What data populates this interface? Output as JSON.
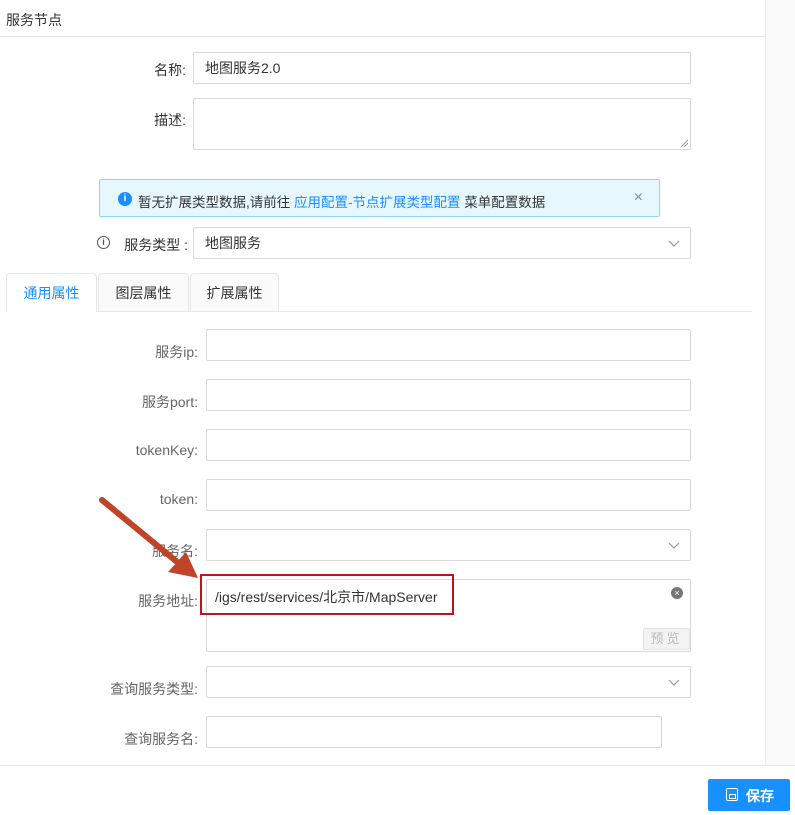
{
  "header": {
    "title": "服务节点"
  },
  "form": {
    "name_label": "名称:",
    "name_value": "地图服务2.0",
    "desc_label": "描述:",
    "desc_value": ""
  },
  "alert": {
    "text_prefix": "暂无扩展类型数据,请前往 ",
    "link": "应用配置-节点扩展类型配置",
    "text_suffix": " 菜单配置数据",
    "close": "×"
  },
  "service_type": {
    "label": "服务类型 :",
    "value": "地图服务"
  },
  "tabs": [
    {
      "label": "通用属性",
      "active": true
    },
    {
      "label": "图层属性",
      "active": false
    },
    {
      "label": "扩展属性",
      "active": false
    }
  ],
  "fields": {
    "ip_label": "服务ip:",
    "port_label": "服务port:",
    "tokenkey_label": "tokenKey:",
    "token_label": "token:",
    "service_name_label": "服务名:",
    "address_label": "服务地址:",
    "address_value": "/igs/rest/services/北京市/MapServer",
    "preview_label": "预览",
    "query_type_label": "查询服务类型:",
    "query_name_label": "查询服务名:"
  },
  "footer": {
    "save_label": "保存"
  },
  "colors": {
    "accent": "#1890ff",
    "highlight": "#c0121d",
    "arrow": "#c0442a"
  },
  "icons": {
    "info": "info-circle-icon",
    "close": "close-icon",
    "dropdown": "chevron-down-icon",
    "clear": "clear-circle-icon",
    "save": "save-icon",
    "annotation": "annotation-arrow-icon"
  }
}
